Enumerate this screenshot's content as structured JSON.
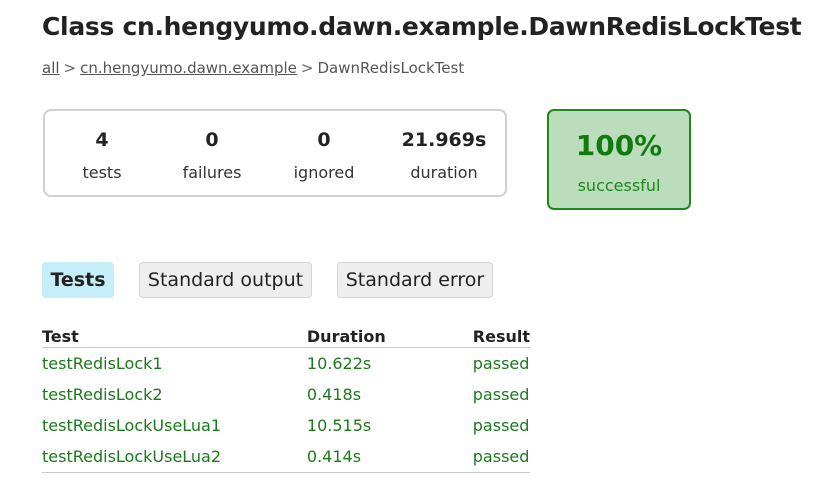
{
  "header": {
    "title": "Class cn.hengyumo.dawn.example.DawnRedisLockTest"
  },
  "breadcrumb": {
    "root_link": "all",
    "package_link": "cn.hengyumo.dawn.example",
    "current": "DawnRedisLockTest",
    "separator": ">"
  },
  "summary": {
    "tests": {
      "value": "4",
      "label": "tests"
    },
    "failures": {
      "value": "0",
      "label": "failures"
    },
    "ignored": {
      "value": "0",
      "label": "ignored"
    },
    "duration": {
      "value": "21.969s",
      "label": "duration"
    }
  },
  "success": {
    "percent": "100%",
    "label": "successful",
    "color": "#107a10",
    "background": "#bbddbb"
  },
  "tabs": [
    {
      "label": "Tests",
      "selected": true
    },
    {
      "label": "Standard output",
      "selected": false
    },
    {
      "label": "Standard error",
      "selected": false
    }
  ],
  "table": {
    "headers": [
      "Test",
      "Duration",
      "Result"
    ],
    "rows": [
      {
        "test": "testRedisLock1",
        "duration": "10.622s",
        "result": "passed"
      },
      {
        "test": "testRedisLock2",
        "duration": "0.418s",
        "result": "passed"
      },
      {
        "test": "testRedisLockUseLua1",
        "duration": "10.515s",
        "result": "passed"
      },
      {
        "test": "testRedisLockUseLua2",
        "duration": "0.414s",
        "result": "passed"
      }
    ],
    "passed_color": "#1a7a1a"
  }
}
